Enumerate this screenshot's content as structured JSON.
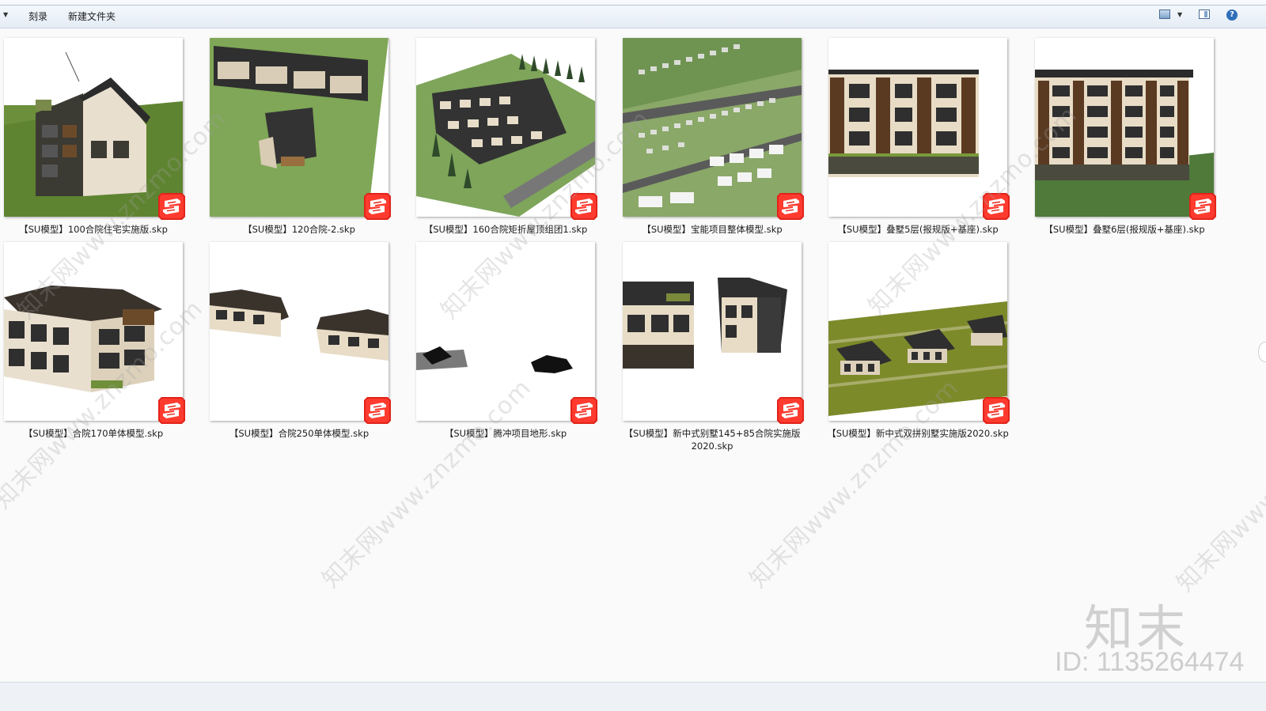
{
  "toolbar": {
    "items": [
      "刻录",
      "新建文件夹"
    ]
  },
  "files": [
    {
      "name": "【SU模型】100合院住宅实施版.skp"
    },
    {
      "name": "【SU模型】120合院-2.skp"
    },
    {
      "name": "【SU模型】160合院矩折屋顶组团1.skp"
    },
    {
      "name": "【SU模型】宝能项目整体模型.skp"
    },
    {
      "name": "【SU模型】叠墅5层(报规版+基座).skp"
    },
    {
      "name": "【SU模型】叠墅6层(报规版+基座).skp"
    },
    {
      "name": "【SU模型】合院170单体模型.skp"
    },
    {
      "name": "【SU模型】合院250单体模型.skp"
    },
    {
      "name": "【SU模型】腾冲项目地形.skp"
    },
    {
      "name": "【SU模型】新中式别墅145+85合院实施版2020.skp"
    },
    {
      "name": "【SU模型】新中式双拼别墅实施版2020.skp"
    }
  ],
  "watermark": {
    "text": "知末网www.znzmo.com",
    "logo": "知末",
    "id": "ID: 1135264474"
  }
}
